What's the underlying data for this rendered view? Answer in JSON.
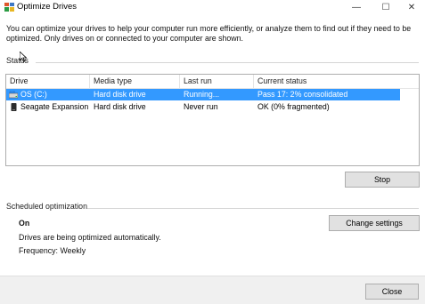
{
  "window": {
    "title": "Optimize Drives",
    "icon": "defrag-app-icon",
    "controls": {
      "minimize": "—",
      "maximize": "☐",
      "close": "✕"
    }
  },
  "intro": "You can optimize your drives to help your computer run more efficiently, or analyze them to find out if they need to be optimized. Only drives on or connected to your computer are shown.",
  "status": {
    "label": "Status",
    "columns": [
      "Drive",
      "Media type",
      "Last run",
      "Current status"
    ],
    "rows": [
      {
        "drive": "OS (C:)",
        "media_type": "Hard disk drive",
        "last_run": "Running...",
        "current_status": "Pass 17: 2% consolidated",
        "icon": "os-drive-icon",
        "selected": true
      },
      {
        "drive": "Seagate Expansion ...",
        "media_type": "Hard disk drive",
        "last_run": "Never run",
        "current_status": "OK (0% fragmented)",
        "icon": "external-drive-icon",
        "selected": false
      }
    ],
    "stop_button": "Stop"
  },
  "scheduled": {
    "label": "Scheduled optimization",
    "state": "On",
    "description": "Drives are being optimized automatically.",
    "frequency": "Frequency: Weekly",
    "change_settings_button": "Change settings"
  },
  "footer": {
    "close_button": "Close"
  },
  "colors": {
    "selection": "#3399ff",
    "button_face": "#e1e1e1",
    "footer": "#f0f0f0"
  }
}
